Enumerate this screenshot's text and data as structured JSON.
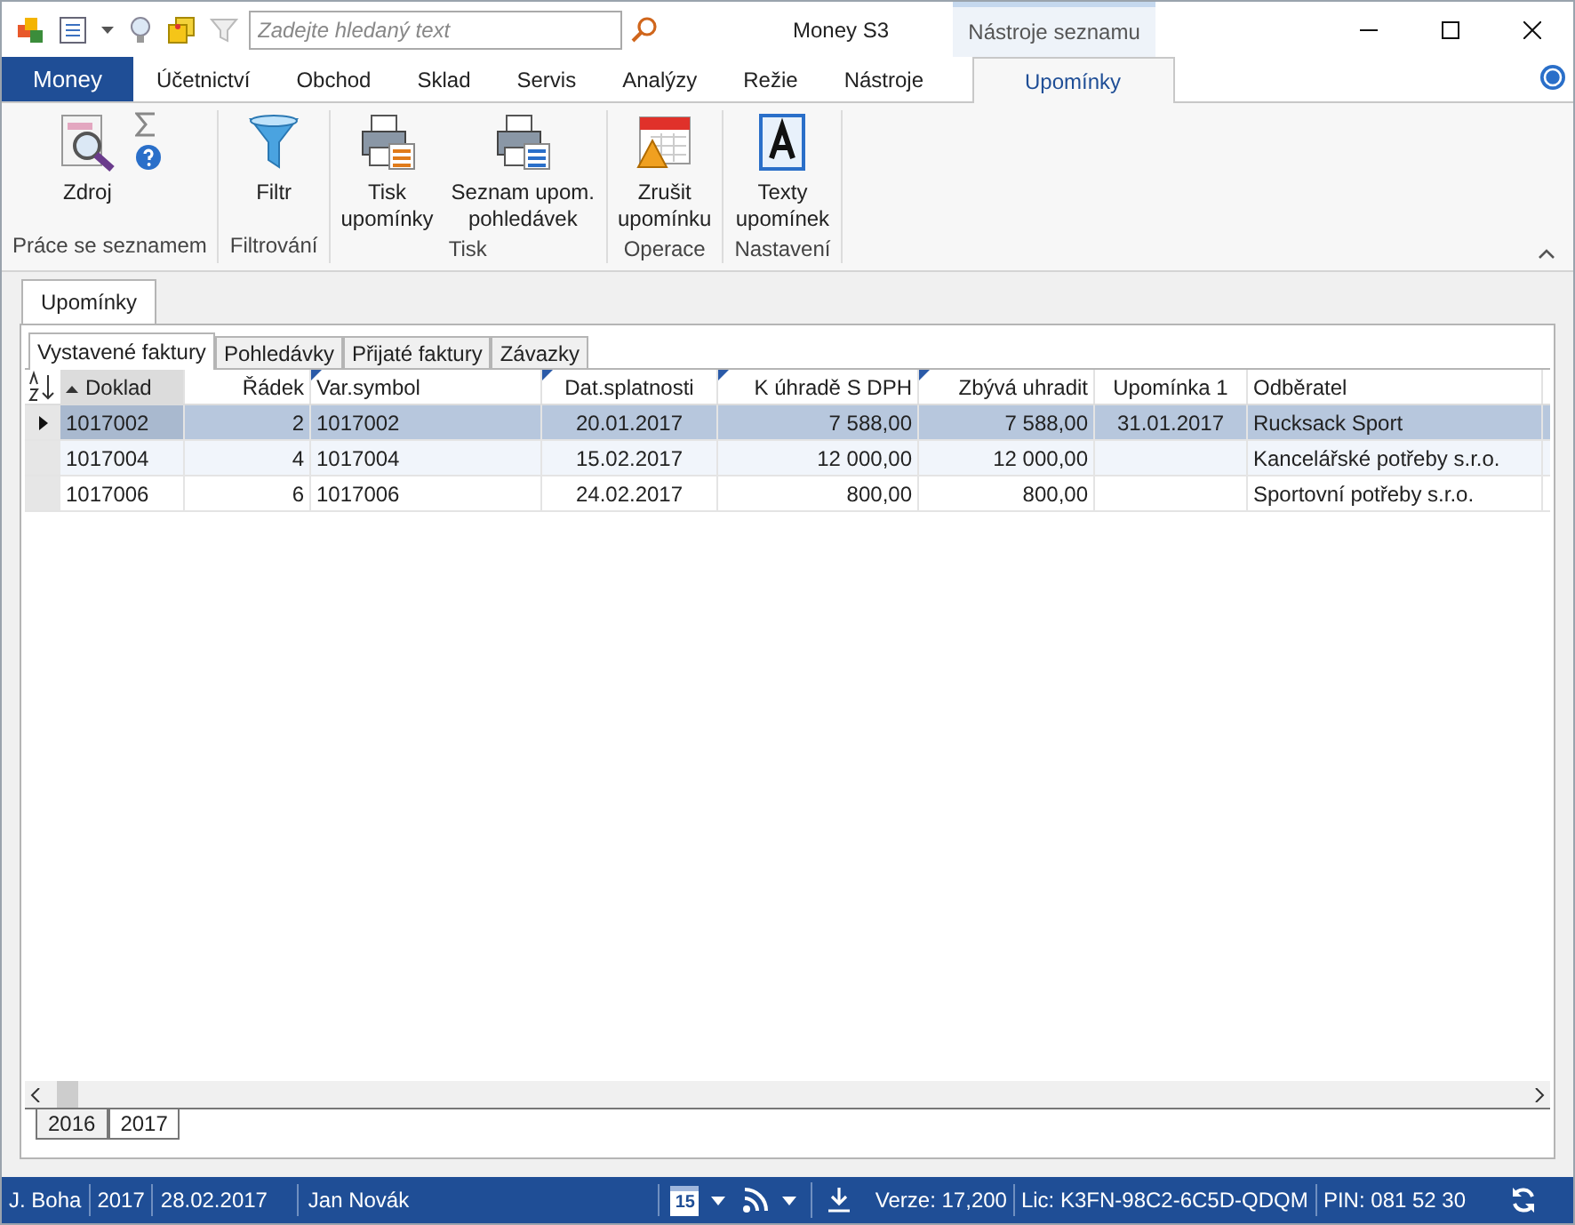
{
  "window": {
    "title": "Money S3",
    "context_tab": "Nástroje seznamu",
    "search": {
      "placeholder": "Zadejte hledaný text"
    }
  },
  "menu_tabs": [
    {
      "label": "Money",
      "kind": "app",
      "selected": false
    },
    {
      "label": "Účetnictví",
      "kind": "tab",
      "selected": false
    },
    {
      "label": "Obchod",
      "kind": "tab",
      "selected": false
    },
    {
      "label": "Sklad",
      "kind": "tab",
      "selected": false
    },
    {
      "label": "Servis",
      "kind": "tab",
      "selected": false
    },
    {
      "label": "Analýzy",
      "kind": "tab",
      "selected": false
    },
    {
      "label": "Režie",
      "kind": "tab",
      "selected": false
    },
    {
      "label": "Nástroje",
      "kind": "tab",
      "selected": false
    },
    {
      "label": "Upomínky",
      "kind": "tab",
      "selected": true
    }
  ],
  "ribbon_groups": [
    {
      "label": "Práce se seznamem",
      "buttons": [
        {
          "kind": "source",
          "lines": [
            "Zdroj"
          ]
        }
      ]
    },
    {
      "label": "Filtrování",
      "buttons": [
        {
          "kind": "filter",
          "lines": [
            "Filtr"
          ]
        }
      ]
    },
    {
      "label": "Tisk",
      "buttons": [
        {
          "kind": "print",
          "lines": [
            "Tisk",
            "upomínky"
          ]
        },
        {
          "kind": "print-list",
          "lines": [
            "Seznam upom.",
            "pohledávek"
          ]
        }
      ]
    },
    {
      "label": "Operace",
      "buttons": [
        {
          "kind": "cancel",
          "lines": [
            "Zrušit",
            "upomínku"
          ]
        }
      ]
    },
    {
      "label": "Nastavení",
      "buttons": [
        {
          "kind": "text",
          "lines": [
            "Texty",
            "upomínek"
          ]
        }
      ]
    }
  ],
  "document_tab": {
    "label": "Upomínky"
  },
  "sub_tabs": [
    {
      "label": "Vystavené faktury",
      "selected": true
    },
    {
      "label": "Pohledávky",
      "selected": false
    },
    {
      "label": "Přijaté faktury",
      "selected": false
    },
    {
      "label": "Závazky",
      "selected": false
    }
  ],
  "table": {
    "columns": [
      {
        "label": "Doklad",
        "marked": false,
        "sorted": true
      },
      {
        "label": "Řádek",
        "marked": false,
        "sorted": false
      },
      {
        "label": "Var.symbol",
        "marked": true,
        "sorted": false
      },
      {
        "label": "Dat.splatnosti",
        "marked": true,
        "sorted": false
      },
      {
        "label": "K úhradě S DPH",
        "marked": true,
        "sorted": false
      },
      {
        "label": "Zbývá uhradit",
        "marked": true,
        "sorted": false
      },
      {
        "label": "Upomínka 1",
        "marked": false,
        "sorted": false
      },
      {
        "label": "Odběratel",
        "marked": false,
        "sorted": false
      }
    ],
    "rows": [
      {
        "selected": true,
        "cells": [
          "1017002",
          "2",
          "1017002",
          "20.01.2017",
          "7 588,00",
          "7 588,00",
          "31.01.2017",
          "Rucksack Sport"
        ]
      },
      {
        "selected": false,
        "cells": [
          "1017004",
          "4",
          "1017004",
          "15.02.2017",
          "12 000,00",
          "12 000,00",
          "",
          "Kancelářské potřeby s.r.o."
        ]
      },
      {
        "selected": false,
        "cells": [
          "1017006",
          "6",
          "1017006",
          "24.02.2017",
          "800,00",
          "800,00",
          "",
          "Sportovní potřeby s.r.o."
        ]
      }
    ]
  },
  "year_tabs": [
    {
      "label": "2016",
      "selected": false
    },
    {
      "label": "2017",
      "selected": true
    }
  ],
  "status_bar": {
    "user": "J. Boha",
    "year": "2017",
    "date": "28.02.2017",
    "name": "Jan Novák",
    "calendar_day": "15",
    "version": "Verze: 17,200",
    "license": "Lic: K3FN-98C2-6C5D-QDQM",
    "pin": "PIN: 081 52 30"
  }
}
